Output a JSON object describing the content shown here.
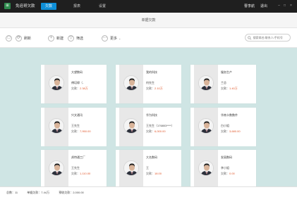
{
  "app": {
    "title": "免追哥欠款"
  },
  "nav": {
    "tabs": [
      {
        "label": "欠款"
      },
      {
        "label": "报表"
      },
      {
        "label": "设置"
      }
    ]
  },
  "header": {
    "user": "曹李航",
    "logout": "退出"
  },
  "page": {
    "title": "单据欠款"
  },
  "toolbar": {
    "refresh_label": "刷新",
    "new_label": "新建",
    "filter_label": "筛选",
    "more_label": "更多",
    "search_placeholder": "搜索商名/联系人/手机号"
  },
  "cards": [
    {
      "name": "大望数码",
      "person": "傅培棣（-",
      "debt_label": "欠款：",
      "amount": "2.38万"
    },
    {
      "name": "我的科技",
      "person": "何先生",
      "debt_label": "欠款：",
      "amount": "2.10万"
    },
    {
      "name": "服务生产",
      "person": "兰总",
      "debt_label": "欠款：",
      "amount": "1.40万"
    },
    {
      "name": "兴文通讯",
      "person": "王先生",
      "debt_label": "欠款：",
      "amount": "7,950.00"
    },
    {
      "name": "华为科技",
      "person": "王先生（176803****）",
      "debt_label": "欠款：",
      "amount": "6,000.00"
    },
    {
      "name": "华南卡数数件",
      "person": "白小姐",
      "debt_label": "欠款：",
      "amount": "3,680.00"
    },
    {
      "name": "邦特通工厂",
      "person": "王先生",
      "debt_label": "欠款：",
      "amount": "1,110.00"
    },
    {
      "name": "大名数码",
      "person": "王",
      "debt_label": "欠款：",
      "amount": "18.00"
    },
    {
      "name": "发丽数码",
      "person": "李小姐",
      "debt_label": "欠款：",
      "amount": "0.00"
    }
  ],
  "footer": {
    "count": "总数：11",
    "total": "单据欠款：7.44万",
    "reserve": "预收欠款：2,000.00"
  },
  "colors": {
    "topbar": "#1f1f1f",
    "accent": "#0e8fd8",
    "content_bg": "#cfe5e4",
    "amount": "#e0582b",
    "logo": "#2e8b4d"
  }
}
